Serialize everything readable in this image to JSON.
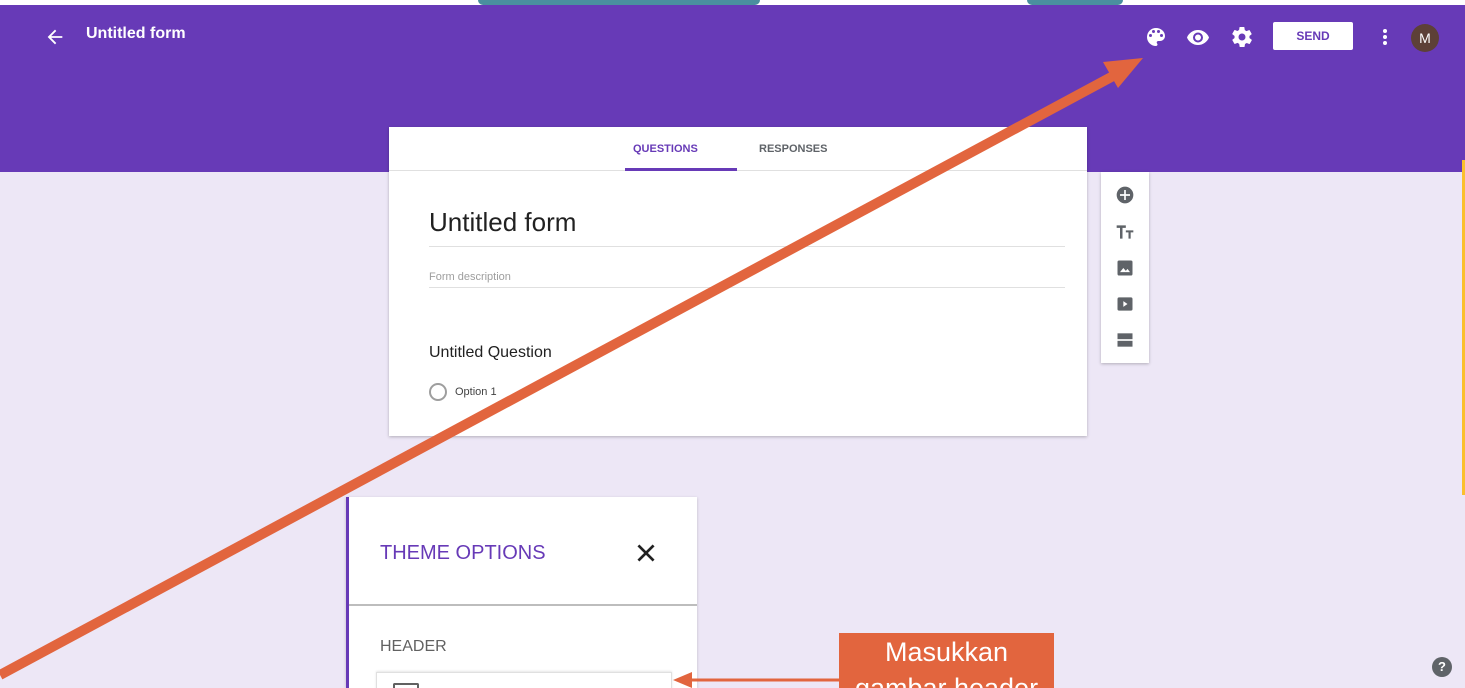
{
  "app": {
    "form_title": "Untitled form",
    "send_label": "SEND",
    "avatar_initial": "M",
    "accent_color": "#673ab7",
    "header_icons": [
      "palette-icon",
      "eye-icon",
      "gear-icon",
      "more-vert-icon"
    ]
  },
  "tabs": [
    {
      "label": "QUESTIONS",
      "active": true
    },
    {
      "label": "RESPONSES",
      "active": false
    }
  ],
  "form": {
    "title": "Untitled form",
    "description_placeholder": "Form description",
    "question": "Untitled Question",
    "option_1": "Option 1"
  },
  "toolbar": {
    "icons": [
      "add-question-icon",
      "title-text-icon",
      "image-icon",
      "video-icon",
      "section-icon"
    ]
  },
  "theme_panel": {
    "title": "THEME OPTIONS",
    "section_label": "HEADER"
  },
  "annotation": {
    "callout_line1": "Masukkan",
    "callout_line2": "gambar header",
    "callout_color": "#e2653e"
  }
}
